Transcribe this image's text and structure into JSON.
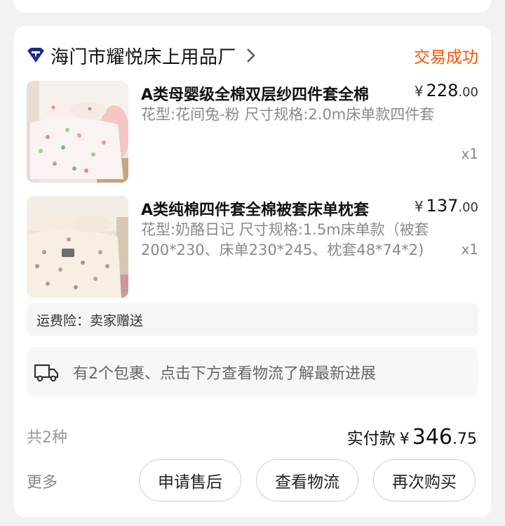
{
  "order": {
    "shop_name": "海门市耀悦床上用品厂",
    "status": "交易成功",
    "items": [
      {
        "title": "A类母婴级全棉双层纱四件套全棉",
        "price_int": "228",
        "price_dec": ".00",
        "spec": "花型:花间兔-粉 尺寸规格:2.0m床单款四件套",
        "qty": "x1"
      },
      {
        "title": "A类纯棉四件套全棉被套床单枕套",
        "price_int": "137",
        "price_dec": ".00",
        "spec": "花型:奶酪日记 尺寸规格:1.5m床单款（被套200*230、床单230*245、枕套48*74*2)",
        "qty": "x1"
      }
    ],
    "insurance_text": "运费险：卖家赠送",
    "logistics_text": "有2个包裹、点击下方查看物流了解最新进展",
    "count_text": "共2种",
    "total_label": "实付款",
    "currency": "¥",
    "total_int": "346",
    "total_dec": ".75",
    "more_label": "更多",
    "buttons": {
      "after_sale": "申请售后",
      "logistics": "查看物流",
      "rebuy": "再次购买"
    }
  },
  "colors": {
    "status": "#ff5000",
    "shop_icon": "#1e2a8c",
    "background": "#f2f2f2"
  },
  "icons": {
    "shop": "tmall-diamond-icon",
    "chevron": "chevron-right-icon",
    "truck": "truck-icon"
  }
}
